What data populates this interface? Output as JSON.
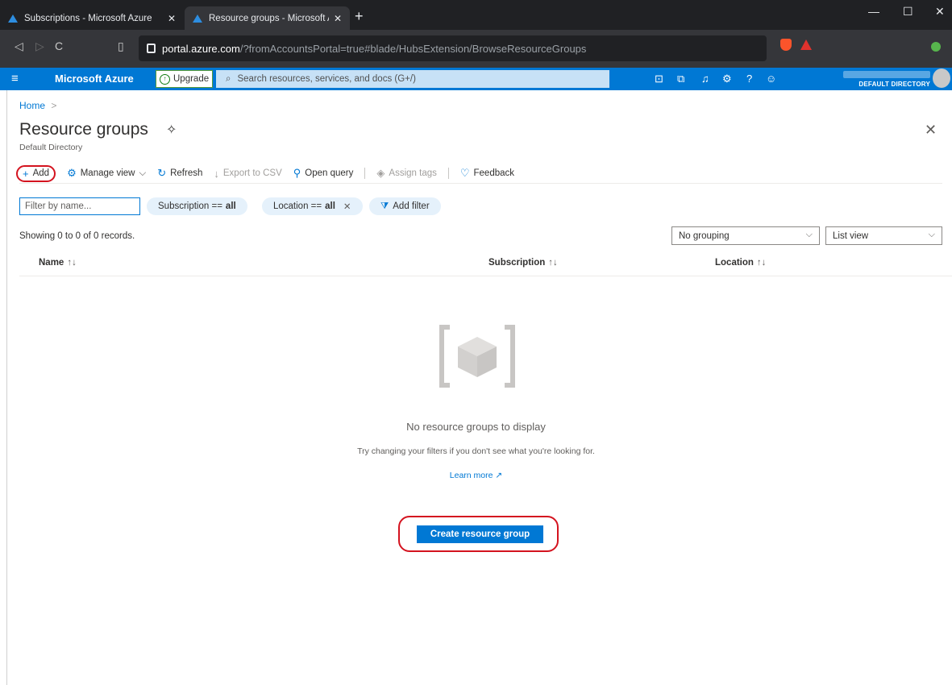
{
  "browser": {
    "tabs": [
      {
        "title": "Subscriptions - Microsoft Azure",
        "active": false
      },
      {
        "title": "Resource groups - Microsoft Azure",
        "active": true
      }
    ],
    "new_tab": "+",
    "window_controls": {
      "minimize": "—",
      "maximize": "☐",
      "close": "✕"
    },
    "url": {
      "host": "portal.azure.com",
      "path": "/?fromAccountsPortal=true#blade/HubsExtension/BrowseResourceGroups"
    }
  },
  "azure_header": {
    "brand": "Microsoft Azure",
    "upgrade_label": "Upgrade",
    "search_placeholder": "Search resources, services, and docs (G+/)",
    "directory": "DEFAULT DIRECTORY",
    "icons": [
      "cloud-shell-icon",
      "directory-filter-icon",
      "notifications-icon",
      "settings-icon",
      "help-icon",
      "feedback-icon"
    ]
  },
  "breadcrumb": {
    "home": "Home",
    "separator": ">"
  },
  "page": {
    "title": "Resource groups",
    "subtitle": "Default Directory"
  },
  "toolbar": {
    "add": "Add",
    "manage_view": "Manage view",
    "refresh": "Refresh",
    "export_csv": "Export to CSV",
    "open_query": "Open query",
    "assign_tags": "Assign tags",
    "feedback": "Feedback"
  },
  "filters": {
    "filter_placeholder": "Filter by name...",
    "subscription": {
      "label": "Subscription ==",
      "value": "all"
    },
    "location": {
      "label": "Location ==",
      "value": "all"
    },
    "add_filter": "Add filter"
  },
  "records_text": "Showing 0 to 0 of 0 records.",
  "grouping": {
    "selected": "No grouping"
  },
  "view": {
    "selected": "List view"
  },
  "columns": [
    "Name",
    "Subscription",
    "Location"
  ],
  "empty_state": {
    "title": "No resource groups to display",
    "hint": "Try changing your filters if you don't see what you're looking for.",
    "learn_more": "Learn more",
    "create_button": "Create resource group"
  },
  "colors": {
    "accent": "#0078d4",
    "highlight": "#d4131f",
    "pill": "#e5f1fb"
  }
}
